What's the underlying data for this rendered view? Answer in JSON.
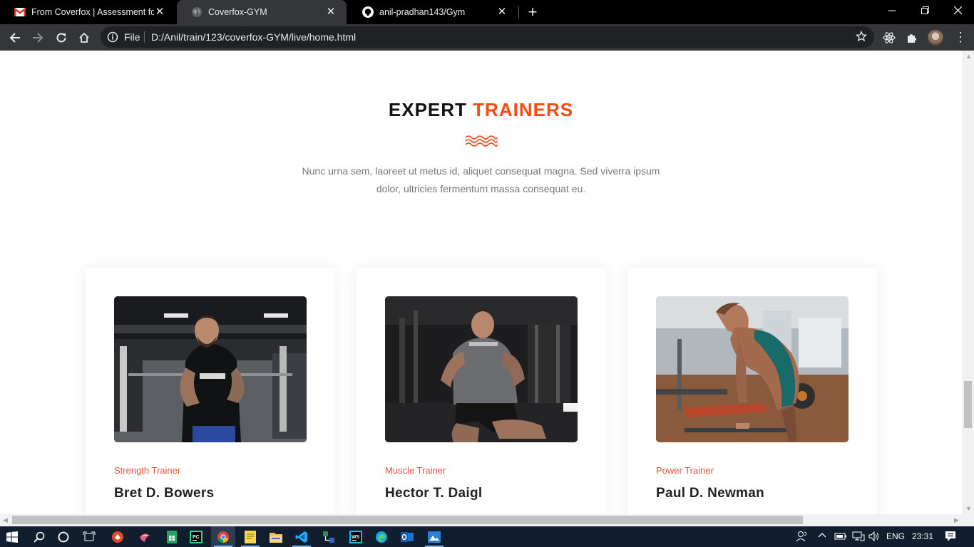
{
  "browser": {
    "tabs": [
      {
        "title": "From Coverfox | Assessment for F",
        "icon": "gmail-icon",
        "active": false
      },
      {
        "title": "Coverfox-GYM",
        "icon": "globe-icon",
        "active": true
      },
      {
        "title": "anil-pradhan143/Gym",
        "icon": "github-icon",
        "active": false
      }
    ],
    "new_tab_label": "+",
    "omnibox": {
      "scheme_label": "File",
      "url": "D:/Anil/train/123/coverfox-GYM/live/home.html"
    }
  },
  "section": {
    "title_part1": "EXPERT",
    "title_part2": "TRAINERS",
    "intro": "Nunc urna sem, laoreet ut metus id, aliquet consequat magna. Sed viverra ipsum dolor, ultricies fermentum massa consequat eu.",
    "accent_color": "#f84a14"
  },
  "trainers": [
    {
      "role": "Strength Trainer",
      "name": "Bret D. Bowers",
      "photo": "trainer-photo-1"
    },
    {
      "role": "Muscle Trainer",
      "name": "Hector T. Daigl",
      "photo": "trainer-photo-2"
    },
    {
      "role": "Power Trainer",
      "name": "Paul D. Newman",
      "photo": "trainer-photo-3"
    }
  ],
  "taskbar": {
    "language": "ENG",
    "time": "23:31"
  }
}
